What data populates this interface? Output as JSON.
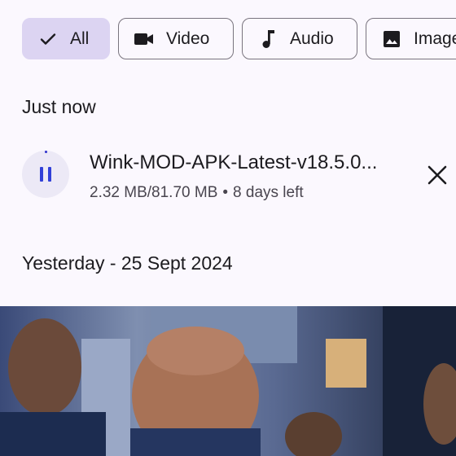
{
  "filters": {
    "all": "All",
    "video": "Video",
    "audio": "Audio",
    "image": "Image"
  },
  "sections": {
    "recent": "Just now",
    "yesterday": "Yesterday - 25 Sept 2024"
  },
  "download": {
    "file_name": "Wink-MOD-APK-Latest-v18.5.0...",
    "progress_text": "2.32 MB/81.70 MB",
    "separator": "•",
    "time_left": "8 days left",
    "status": "paused",
    "progress": 0.028
  },
  "icons": {
    "selected_check": "check-icon",
    "video": "videocam-icon",
    "audio": "music-note-icon",
    "image": "image-icon",
    "pause": "pause-icon",
    "cancel": "close-icon"
  },
  "colors": {
    "background": "#fbf8fe",
    "selected_chip": "#dcd4f2",
    "accent": "#3140d8",
    "text_primary": "#1c1b1f",
    "text_secondary": "#49454f"
  }
}
